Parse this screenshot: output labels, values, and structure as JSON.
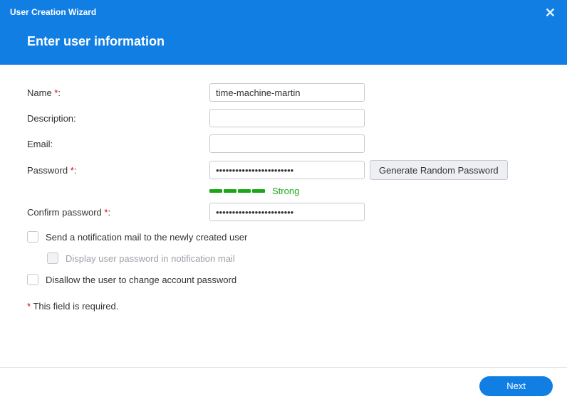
{
  "header": {
    "title": "User Creation Wizard",
    "subtitle": "Enter user information"
  },
  "form": {
    "name": {
      "label": "Name ",
      "value": "time-machine-martin"
    },
    "description": {
      "label": "Description:",
      "value": ""
    },
    "email": {
      "label": "Email:",
      "value": ""
    },
    "password": {
      "label": "Password ",
      "value": "••••••••••••••••••••••••",
      "generate_btn": "Generate Random Password"
    },
    "strength": {
      "label": "Strong"
    },
    "confirm": {
      "label": "Confirm password ",
      "value": "••••••••••••••••••••••••"
    },
    "cb_notify": "Send a notification mail to the newly created user",
    "cb_display_pwd": "Display user password in notification mail",
    "cb_disallow": "Disallow the user to change account password",
    "required_note": " This field is required."
  },
  "footer": {
    "next": "Next"
  },
  "punct": {
    "asterisk": "*",
    "colon": ":"
  }
}
